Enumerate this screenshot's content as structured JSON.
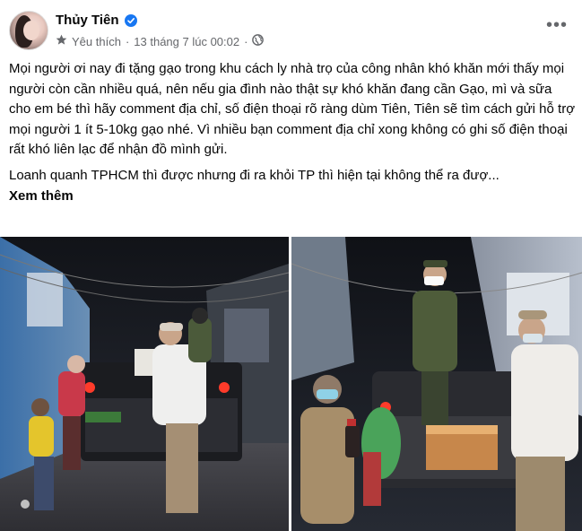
{
  "author": {
    "name": "Thủy Tiên",
    "verified": true
  },
  "meta": {
    "relation": "Yêu thích",
    "separator": "·",
    "timestamp": "13 tháng 7 lúc 00:02",
    "separator2": "·",
    "privacy_icon": "globe-icon"
  },
  "post": {
    "paragraph1": "Mọi người ơi nay đi tặng gạo trong khu cách ly nhà trọ của công nhân khó khăn mới thấy mọi người còn cần nhiều quá, nên nếu gia đình nào thật sự khó khăn đang cần Gạo, mì và sữa cho em bé thì hãy comment địa chỉ, số điện thoại rõ ràng dùm Tiên, Tiên sẽ tìm cách gửi hỗ trợ mọi người 1 ít 5-10kg gạo nhé. Vì nhiều bạn comment địa chỉ xong không có ghi số điện thoại rất khó liên lạc để nhận đồ mình gửi.",
    "paragraph2": "Loanh quanh TPHCM thì được nhưng đi ra khỏi TP thì hiện tại không thể ra đượ...",
    "see_more": "Xem thêm"
  },
  "colors": {
    "verified_badge": "#1877f2",
    "meta_text": "#65676b",
    "text": "#050505"
  }
}
